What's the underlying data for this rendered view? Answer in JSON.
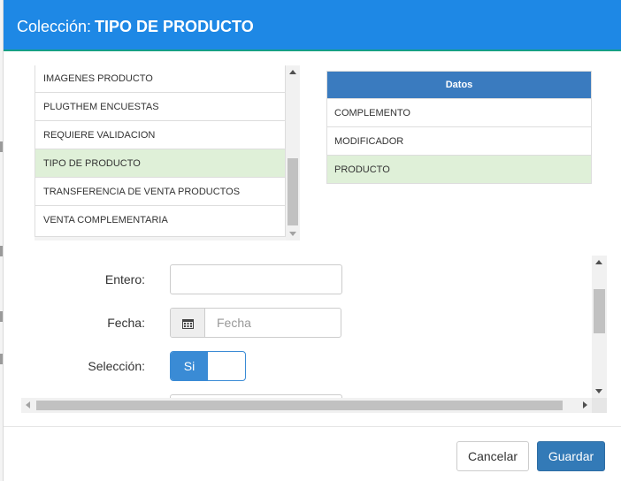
{
  "modal": {
    "title_prefix": "Colección:",
    "title_name": "TIPO DE PRODUCTO"
  },
  "collections_list": {
    "items": [
      {
        "label": "IMAGENES PRODUCTO",
        "selected": false
      },
      {
        "label": "PLUGTHEM ENCUESTAS",
        "selected": false
      },
      {
        "label": "REQUIERE VALIDACION",
        "selected": false
      },
      {
        "label": "TIPO DE PRODUCTO",
        "selected": true
      },
      {
        "label": "TRANSFERENCIA DE VENTA PRODUCTOS",
        "selected": false
      },
      {
        "label": "VENTA COMPLEMENTARIA",
        "selected": false
      }
    ]
  },
  "datos_table": {
    "header": "Datos",
    "rows": [
      {
        "label": "COMPLEMENTO",
        "selected": false
      },
      {
        "label": "MODIFICADOR",
        "selected": false
      },
      {
        "label": "PRODUCTO",
        "selected": true
      }
    ]
  },
  "form": {
    "entero_label": "Entero:",
    "entero_value": "",
    "fecha_label": "Fecha:",
    "fecha_placeholder": "Fecha",
    "seleccion_label": "Selección:",
    "seleccion_toggle_label": "Si",
    "seleccion_value": true
  },
  "footer": {
    "cancel_label": "Cancelar",
    "save_label": "Guardar"
  },
  "colors": {
    "header_bg": "#1e88e5",
    "header_border": "#16a085",
    "datos_header_bg": "#3a7bbf",
    "selected_row_bg": "#dff0d8",
    "primary_button": "#337ab7"
  },
  "icons": {
    "date_addon": "calendar-icon"
  }
}
